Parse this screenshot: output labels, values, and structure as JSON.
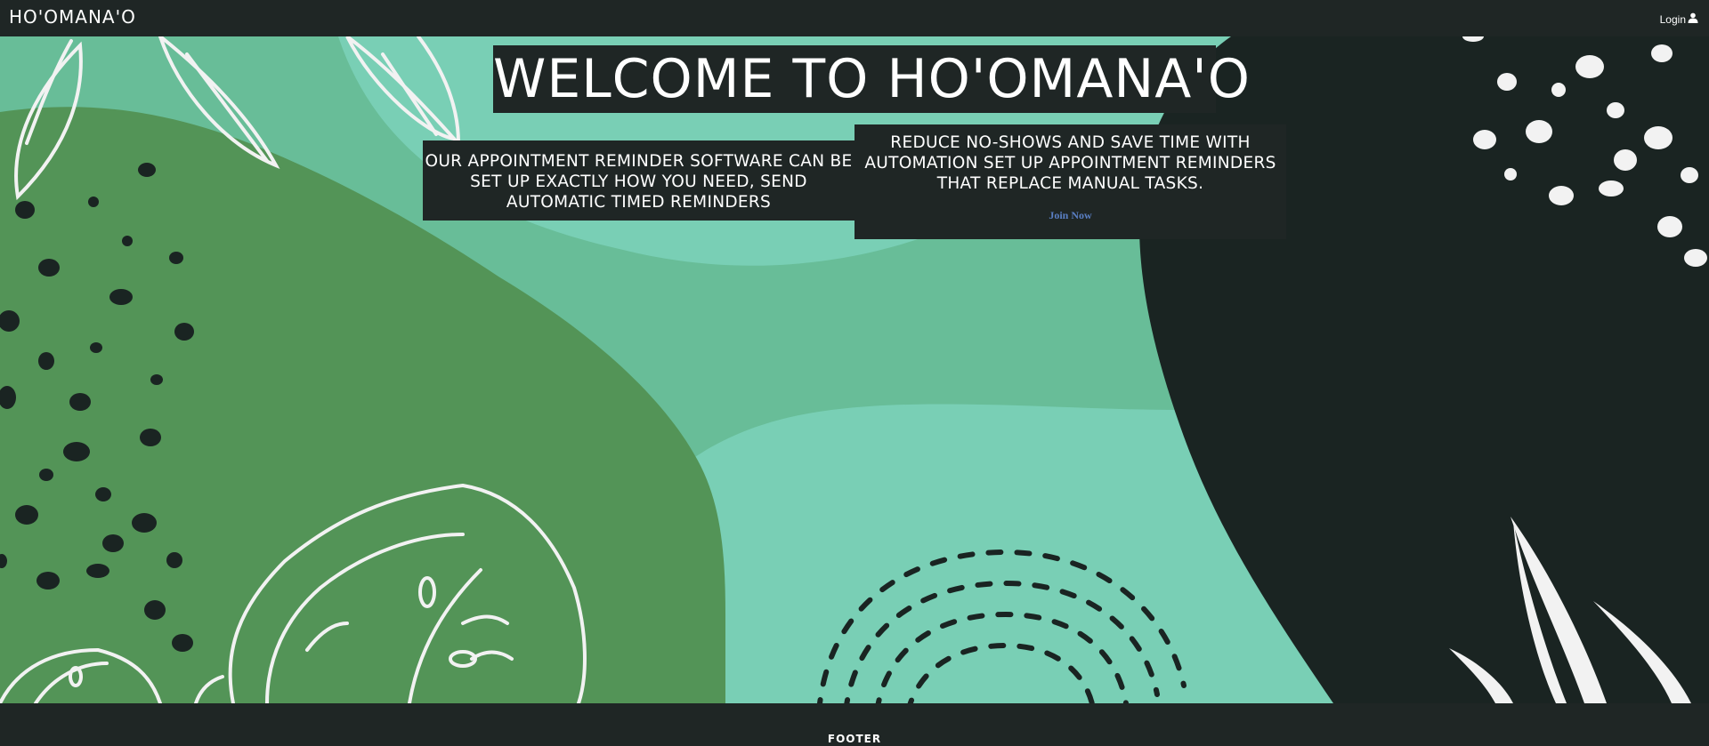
{
  "nav": {
    "brand": "HO'OMANA'O",
    "login_label": "Login"
  },
  "icons": {
    "login": "user-icon"
  },
  "hero": {
    "title": "WELCOME TO HO'OMANA'O",
    "left_card_text": "OUR APPOINTMENT REMINDER SOFTWARE CAN BE SET UP EXACTLY HOW YOU NEED, SEND AUTOMATIC TIMED REMINDERS",
    "right_card_text": "REDUCE NO-SHOWS AND SAVE TIME WITH AUTOMATION SET UP APPOINTMENT REMINDERS THAT REPLACE MANUAL TASKS.",
    "cta_label": "Join Now"
  },
  "footer": {
    "label": "FOOTER"
  },
  "colors": {
    "dark": "#1f2625",
    "mint": "#79cfb5",
    "green_mid": "#68bd98",
    "green_dark": "#539457",
    "link": "#5a7fc4"
  }
}
